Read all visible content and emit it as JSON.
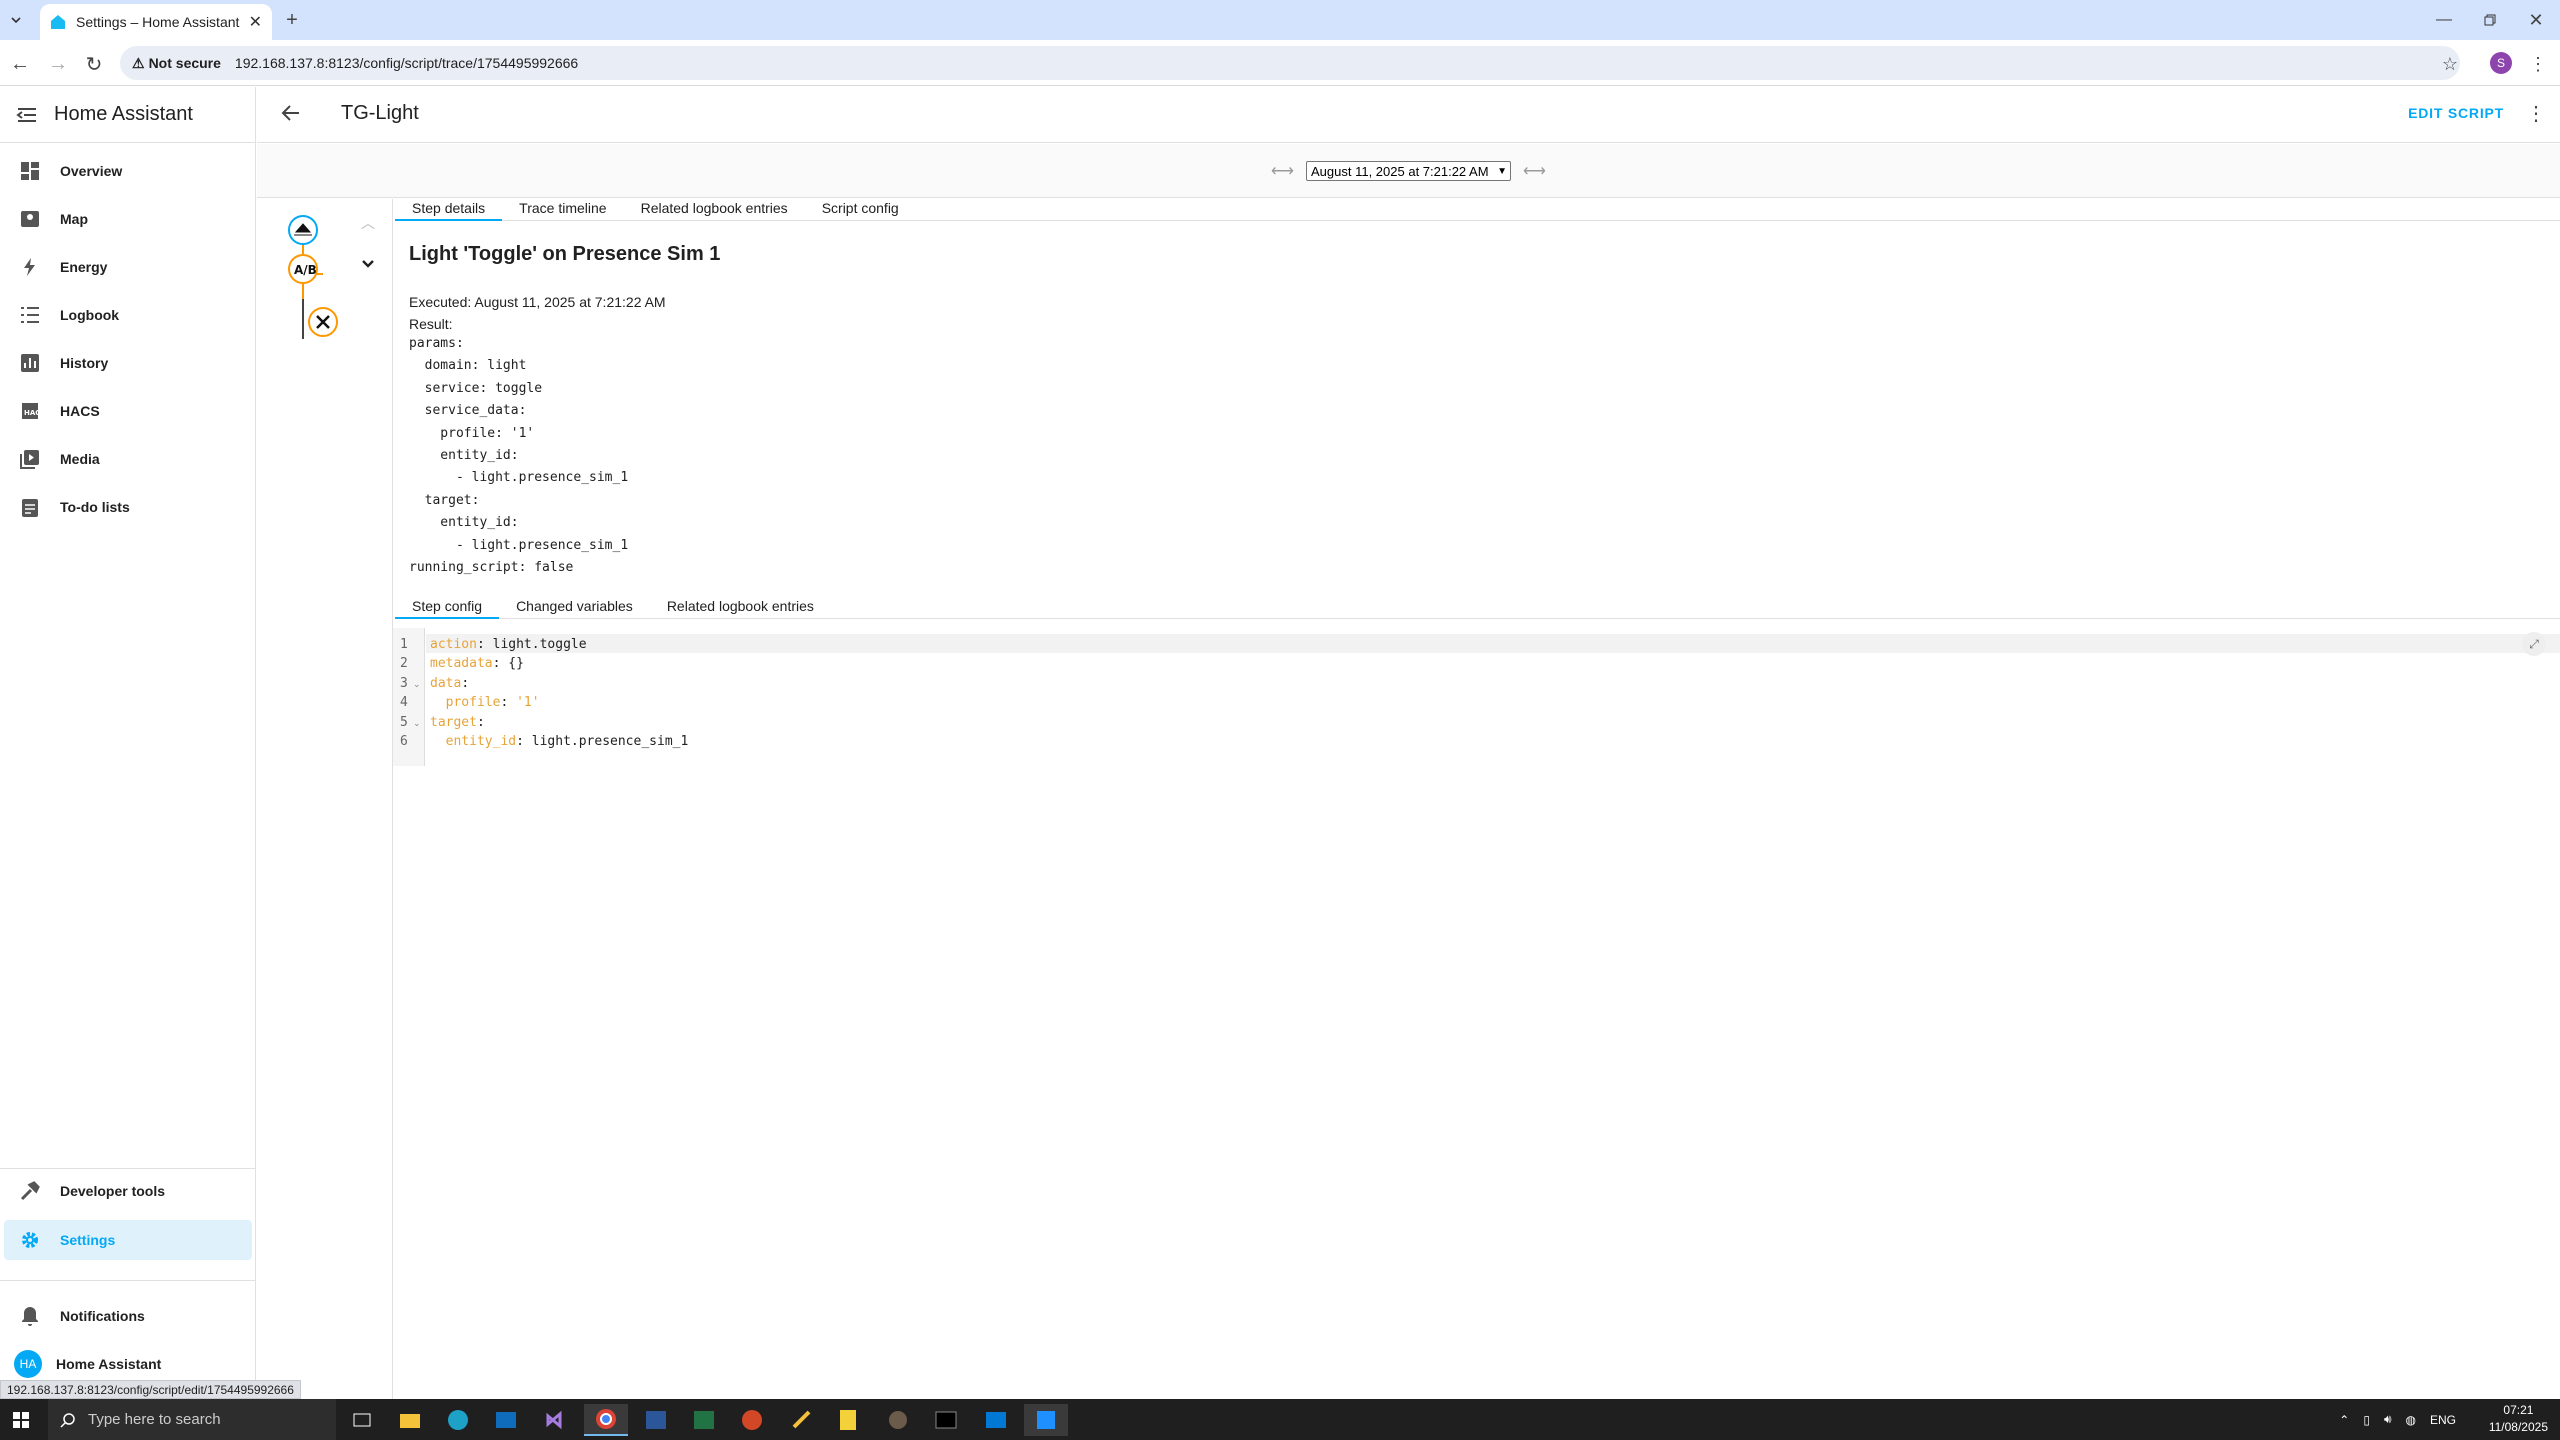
{
  "browser": {
    "tab_title": "Settings – Home Assistant",
    "security_label": "Not secure",
    "url": "192.168.137.8:8123/config/script/trace/1754495992666",
    "profile_initial": "S",
    "status_url": "192.168.137.8:8123/config/script/edit/1754495992666"
  },
  "sidebar": {
    "title": "Home Assistant",
    "items": [
      {
        "label": "Overview",
        "icon": "dashboard-icon"
      },
      {
        "label": "Map",
        "icon": "map-icon"
      },
      {
        "label": "Energy",
        "icon": "lightning-icon"
      },
      {
        "label": "Logbook",
        "icon": "list-icon"
      },
      {
        "label": "History",
        "icon": "chart-icon"
      },
      {
        "label": "HACS",
        "icon": "hacs-icon"
      },
      {
        "label": "Media",
        "icon": "media-icon"
      },
      {
        "label": "To-do lists",
        "icon": "clipboard-icon"
      }
    ],
    "developer_tools": "Developer tools",
    "settings": "Settings",
    "notifications": "Notifications",
    "user_initials": "HA",
    "user_name": "Home Assistant"
  },
  "header": {
    "title": "TG-Light",
    "edit_script": "EDIT SCRIPT"
  },
  "trace": {
    "selected": "August 11, 2025 at 7:21:22 AM"
  },
  "tabs_top": [
    "Step details",
    "Trace timeline",
    "Related logbook entries",
    "Script config"
  ],
  "step": {
    "title": "Light 'Toggle' on Presence Sim 1",
    "executed": "Executed: August 11, 2025 at 7:21:22 AM",
    "result_label": "Result:",
    "yaml": "params:\n  domain: light\n  service: toggle\n  service_data:\n    profile: '1'\n    entity_id:\n      - light.presence_sim_1\n  target:\n    entity_id:\n      - light.presence_sim_1\nrunning_script: false"
  },
  "tabs_bottom": [
    "Step config",
    "Changed variables",
    "Related logbook entries"
  ],
  "editor": {
    "line_numbers": [
      "1",
      "2",
      "3",
      "4",
      "5",
      "6"
    ],
    "lines": [
      {
        "k": "action",
        "v": " light.toggle",
        "indent": ""
      },
      {
        "k": "metadata",
        "v": " {}",
        "indent": ""
      },
      {
        "k": "data",
        "v": "",
        "indent": ""
      },
      {
        "k": "profile",
        "v": " '1'",
        "indent": "  "
      },
      {
        "k": "target",
        "v": "",
        "indent": ""
      },
      {
        "k": "entity_id",
        "v": " light.presence_sim_1",
        "indent": "  "
      }
    ]
  },
  "taskbar": {
    "search_placeholder": "Type here to search",
    "lang": "ENG",
    "time": "07:21",
    "date": "11/08/2025"
  },
  "colors": {
    "accent": "#03a9f4",
    "trace_orange": "#ff9800"
  }
}
